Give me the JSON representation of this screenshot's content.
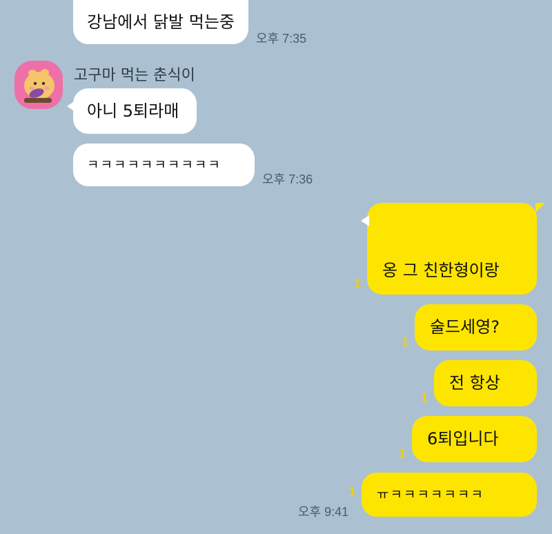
{
  "messages": {
    "m1": {
      "text": "강남에서 닭발 먹는중",
      "time": "오후 7:35"
    },
    "sender": {
      "name": "고구마 먹는 춘식이",
      "avatar_icon": "chunsik-sweet-potato-avatar-icon"
    },
    "m2": {
      "text": "아니 5퇴라매"
    },
    "m3": {
      "text": "ㅋㅋㅋㅋㅋㅋㅋㅋㅋㅋ",
      "time": "오후 7:36"
    },
    "m4": {
      "text": "옹 그 친한형이랑",
      "unread": "1"
    },
    "m5": {
      "text": "술드세영?",
      "unread": "1"
    },
    "m6": {
      "text": "전 항상",
      "unread": "1"
    },
    "m7": {
      "text": "6퇴입니다",
      "unread": "1"
    },
    "m8": {
      "text": "ㅠㅋㅋㅋㅋㅋㅋㅋ",
      "time": "오후 9:41",
      "unread": "1"
    }
  },
  "colors": {
    "background": "#abc1d1",
    "incoming_bubble": "#ffffff",
    "outgoing_bubble": "#fee500",
    "unread_count": "#f4d000"
  }
}
